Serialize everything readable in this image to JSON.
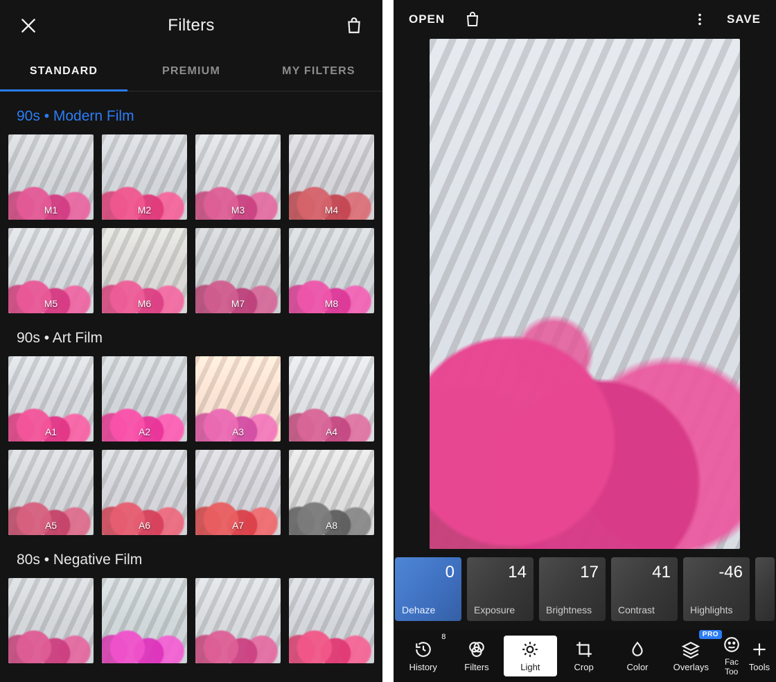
{
  "left": {
    "title": "Filters",
    "tabs": [
      "STANDARD",
      "PREMIUM",
      "MY FILTERS"
    ],
    "active_tab": 0,
    "sections": [
      {
        "title": "90s • Modern Film",
        "link": true,
        "filters": [
          "M1",
          "M2",
          "M3",
          "M4",
          "M5",
          "M6",
          "M7",
          "M8"
        ]
      },
      {
        "title": "90s • Art Film",
        "link": false,
        "filters": [
          "A1",
          "A2",
          "A3",
          "A4",
          "A5",
          "A6",
          "A7",
          "A8"
        ]
      },
      {
        "title": "80s • Negative Film",
        "link": false,
        "filters": [
          "",
          "",
          "",
          ""
        ]
      }
    ]
  },
  "right": {
    "open": "OPEN",
    "save": "SAVE",
    "adjust": [
      {
        "name": "Dehaze",
        "value": "0",
        "active": true
      },
      {
        "name": "Exposure",
        "value": "14",
        "active": false
      },
      {
        "name": "Brightness",
        "value": "17",
        "active": false
      },
      {
        "name": "Contrast",
        "value": "41",
        "active": false
      },
      {
        "name": "Highlights",
        "value": "-46",
        "active": false
      }
    ],
    "toolbar": {
      "history": "History",
      "history_count": "8",
      "filters": "Filters",
      "light": "Light",
      "crop": "Crop",
      "color": "Color",
      "overlays": "Overlays",
      "overlays_badge": "PRO",
      "face": "Face Tools",
      "tools": "Tools"
    }
  }
}
